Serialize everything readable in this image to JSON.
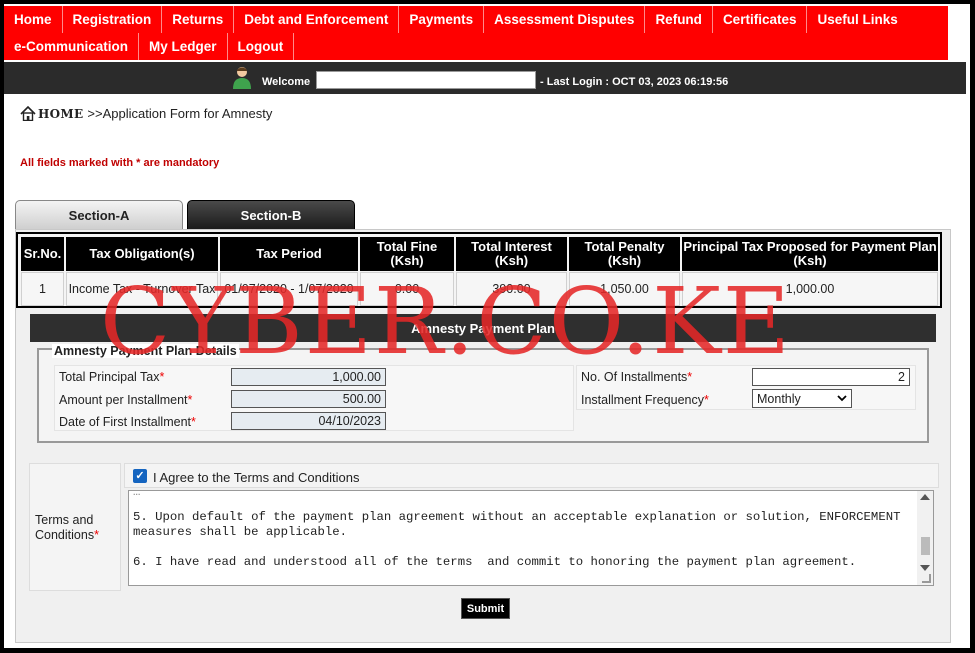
{
  "nav": {
    "row1": [
      "Home",
      "Registration",
      "Returns",
      "Debt and Enforcement",
      "Payments",
      "Assessment Disputes",
      "Refund",
      "Certificates",
      "Useful Links"
    ],
    "row2": [
      "e-Communication",
      "My Ledger",
      "Logout"
    ]
  },
  "welcome": {
    "label": "Welcome",
    "last_login": "- Last Login : OCT 03, 2023 06:19:56"
  },
  "breadcrumb": {
    "home": "HOME",
    "current": ">>Application Form for Amnesty"
  },
  "mandatory_note": "All fields marked with * are mandatory",
  "tabs": [
    "Section-A",
    "Section-B"
  ],
  "tax_table": {
    "headers": [
      "Sr.No.",
      "Tax Obligation(s)",
      "Tax Period",
      "Total Fine (Ksh)",
      "Total Interest (Ksh)",
      "Total Penalty (Ksh)",
      "Principal Tax Proposed for Payment Plan (Ksh)"
    ],
    "rows": [
      [
        "1",
        "Income Tax - Turnover Tax",
        "01/07/2020 - 1/07/2020",
        "0.00",
        "390.00",
        "1,050.00",
        "1,000.00"
      ]
    ]
  },
  "plan": {
    "header": "Amnesty Payment Plan",
    "legend": "Amnesty Payment Plan Details",
    "total_principal_label": "Total Principal Tax",
    "total_principal_value": "1,000.00",
    "amount_per_installment_label": "Amount per Installment",
    "amount_per_installment_value": "500.00",
    "first_installment_label": "Date of First Installment",
    "first_installment_value": "04/10/2023",
    "num_installments_label": "No. Of Installments",
    "num_installments_value": "2",
    "frequency_label": "Installment Frequency",
    "frequency_value": "Monthly",
    "required_mark": "*"
  },
  "terms": {
    "label_line1": "Terms and",
    "label_line2": "Conditions",
    "agree_text": "I Agree to the Terms and Conditions",
    "agree_checked": true,
    "lines": [
      "5. Upon default of the payment plan agreement without an acceptable explanation or solution, ENFORCEMENT",
      "measures shall be applicable.",
      "6. I have read and understood all of the terms  and commit to honoring the payment plan agreement."
    ]
  },
  "submit_label": "Submit",
  "watermark": "CYBER.CO.KE",
  "colors": {
    "nav_bg": "#ff0000",
    "dark_bar": "#2b2b2b",
    "required": "#ee0000",
    "watermark": "#e52828"
  }
}
